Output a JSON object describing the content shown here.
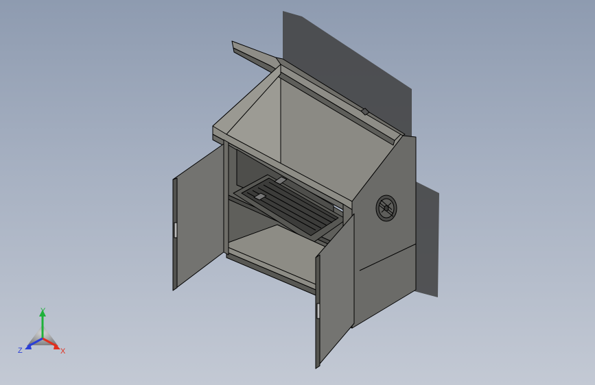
{
  "viewport": {
    "background_top": "#8e9bb0",
    "background_bottom": "#c3c9d4"
  },
  "model": {
    "part": "electrical-enclosure-cabinet",
    "body_color": "#7e7e78",
    "edge_color": "#000000",
    "lid_state": "open",
    "doors_state": "open",
    "features": [
      "hinged-top-lid",
      "two-front-doors",
      "internal-shelf",
      "grille-tray",
      "round-vent-fan"
    ]
  },
  "triad": {
    "x_label": "X",
    "y_label": "Y",
    "z_label": "Z",
    "x_color": "#e0301e",
    "y_color": "#1fb13a",
    "z_color": "#2b3fd6"
  }
}
